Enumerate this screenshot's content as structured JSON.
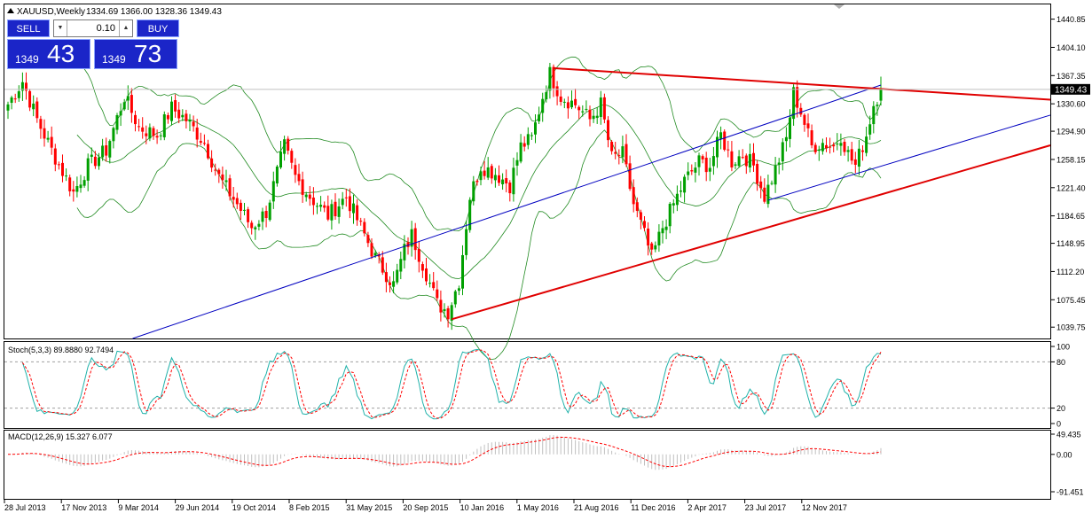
{
  "header": {
    "symbol_line": "XAUUSD,Weekly",
    "ohlc_line": "1334.69 1366.00 1328.36 1349.43"
  },
  "trade_panel": {
    "sell_label": "SELL",
    "buy_label": "BUY",
    "lot": "0.10",
    "sell_small": "1349",
    "sell_big": "43",
    "buy_small": "1349",
    "buy_big": "73",
    "color": "#1b25c8"
  },
  "chart_data": [
    {
      "type": "candlestick",
      "symbol": "XAUUSD",
      "timeframe": "Weekly",
      "ylim": [
        1025,
        1460
      ],
      "y_ticks": [
        "1440.85",
        "1404.10",
        "1367.35",
        "1330.60",
        "1294.90",
        "1258.15",
        "1221.40",
        "1184.65",
        "1148.95",
        "1112.20",
        "1075.45",
        "1039.75"
      ],
      "current_price": "1349.43",
      "current_price_value": 1349.43,
      "x_ticks": [
        "28 Jul 2013",
        "17 Nov 2013",
        "9 Mar 2014",
        "29 Jun 2014",
        "19 Oct 2014",
        "8 Feb 2015",
        "31 May 2015",
        "20 Sep 2015",
        "10 Jan 2016",
        "1 May 2016",
        "21 Aug 2016",
        "11 Dec 2016",
        "2 Apr 2017",
        "23 Jul 2017",
        "12 Nov 2017"
      ],
      "colors": {
        "bull": "#00a000",
        "bear": "#ff0000",
        "bollinger": "#228b22",
        "channel": "#0000c0",
        "trendline": "#e00000"
      },
      "bollinger_period": 20,
      "close_anchors": [
        {
          "week": 0,
          "close": 1330
        },
        {
          "week": 4,
          "close": 1360
        },
        {
          "week": 8,
          "close": 1310
        },
        {
          "week": 12,
          "close": 1270
        },
        {
          "week": 18,
          "close": 1215
        },
        {
          "week": 22,
          "close": 1250
        },
        {
          "week": 27,
          "close": 1270
        },
        {
          "week": 32,
          "close": 1340
        },
        {
          "week": 36,
          "close": 1300
        },
        {
          "week": 41,
          "close": 1290
        },
        {
          "week": 45,
          "close": 1325
        },
        {
          "week": 49,
          "close": 1310
        },
        {
          "week": 54,
          "close": 1280
        },
        {
          "week": 58,
          "close": 1235
        },
        {
          "week": 63,
          "close": 1200
        },
        {
          "week": 67,
          "close": 1170
        },
        {
          "week": 71,
          "close": 1190
        },
        {
          "week": 76,
          "close": 1275
        },
        {
          "week": 79,
          "close": 1235
        },
        {
          "week": 83,
          "close": 1210
        },
        {
          "week": 88,
          "close": 1185
        },
        {
          "week": 93,
          "close": 1210
        },
        {
          "week": 97,
          "close": 1170
        },
        {
          "week": 101,
          "close": 1130
        },
        {
          "week": 106,
          "close": 1095
        },
        {
          "week": 109,
          "close": 1140
        },
        {
          "week": 111,
          "close": 1160
        },
        {
          "week": 115,
          "close": 1110
        },
        {
          "week": 118,
          "close": 1070
        },
        {
          "week": 121,
          "close": 1060
        },
        {
          "week": 124,
          "close": 1100
        },
        {
          "week": 127,
          "close": 1210
        },
        {
          "week": 130,
          "close": 1250
        },
        {
          "week": 134,
          "close": 1240
        },
        {
          "week": 138,
          "close": 1225
        },
        {
          "week": 141,
          "close": 1275
        },
        {
          "week": 144,
          "close": 1285
        },
        {
          "week": 147,
          "close": 1340
        },
        {
          "week": 149,
          "close": 1370
        },
        {
          "week": 152,
          "close": 1340
        },
        {
          "week": 156,
          "close": 1330
        },
        {
          "week": 160,
          "close": 1310
        },
        {
          "week": 163,
          "close": 1330
        },
        {
          "week": 166,
          "close": 1260
        },
        {
          "week": 169,
          "close": 1265
        },
        {
          "week": 172,
          "close": 1200
        },
        {
          "week": 175,
          "close": 1160
        },
        {
          "week": 177,
          "close": 1130
        },
        {
          "week": 180,
          "close": 1170
        },
        {
          "week": 183,
          "close": 1200
        },
        {
          "week": 186,
          "close": 1230
        },
        {
          "week": 190,
          "close": 1255
        },
        {
          "week": 193,
          "close": 1250
        },
        {
          "week": 196,
          "close": 1290
        },
        {
          "week": 199,
          "close": 1255
        },
        {
          "week": 202,
          "close": 1265
        },
        {
          "week": 205,
          "close": 1250
        },
        {
          "week": 208,
          "close": 1210
        },
        {
          "week": 211,
          "close": 1245
        },
        {
          "week": 214,
          "close": 1285
        },
        {
          "week": 216,
          "close": 1345
        },
        {
          "week": 218,
          "close": 1320
        },
        {
          "week": 221,
          "close": 1275
        },
        {
          "week": 224,
          "close": 1280
        },
        {
          "week": 227,
          "close": 1275
        },
        {
          "week": 229,
          "close": 1290
        },
        {
          "week": 231,
          "close": 1265
        },
        {
          "week": 233,
          "close": 1250
        },
        {
          "week": 236,
          "close": 1290
        },
        {
          "week": 238,
          "close": 1330
        },
        {
          "week": 240,
          "close": 1349.43
        }
      ],
      "last_bar": {
        "open": 1334.69,
        "high": 1366.0,
        "low": 1328.36,
        "close": 1349.43
      },
      "annotations": [
        {
          "kind": "channel_line",
          "color": "#0000c0",
          "p1": {
            "week": 0,
            "price": 970
          },
          "p2": {
            "week": 240,
            "price": 1355
          }
        },
        {
          "kind": "channel_line",
          "color": "#0000c0",
          "p1": {
            "week": 209,
            "price": 1205
          },
          "p2": {
            "week": 300,
            "price": 1335
          }
        },
        {
          "kind": "trendline",
          "color": "#e00000",
          "p1": {
            "week": 122,
            "price": 1050
          },
          "p2": {
            "week": 300,
            "price": 1295
          }
        },
        {
          "kind": "trendline",
          "color": "#e00000",
          "p1": {
            "week": 150,
            "price": 1377
          },
          "p2": {
            "week": 300,
            "price": 1332
          }
        }
      ]
    },
    {
      "type": "line",
      "name": "Stoch(5,3,3)",
      "label": "Stoch(5,3,3) 89.8880 92.7494",
      "main": 89.888,
      "signal": 92.7494,
      "ylim": [
        0,
        100
      ],
      "levels": [
        20,
        80
      ],
      "y_ticks": [
        "100",
        "80",
        "20",
        "0"
      ],
      "colors": {
        "main": "#20b2aa",
        "signal": "#ff0000"
      }
    },
    {
      "type": "bar",
      "name": "MACD(12,26,9)",
      "label": "MACD(12,26,9) 15.327 6.077",
      "macd": 15.327,
      "signal": 6.077,
      "y_ticks": [
        "49.435",
        "0.00",
        "-91.451"
      ],
      "ylim": [
        -91.451,
        49.435
      ],
      "colors": {
        "histogram": "#c0c0c0",
        "signal": "#ff0000"
      }
    }
  ]
}
